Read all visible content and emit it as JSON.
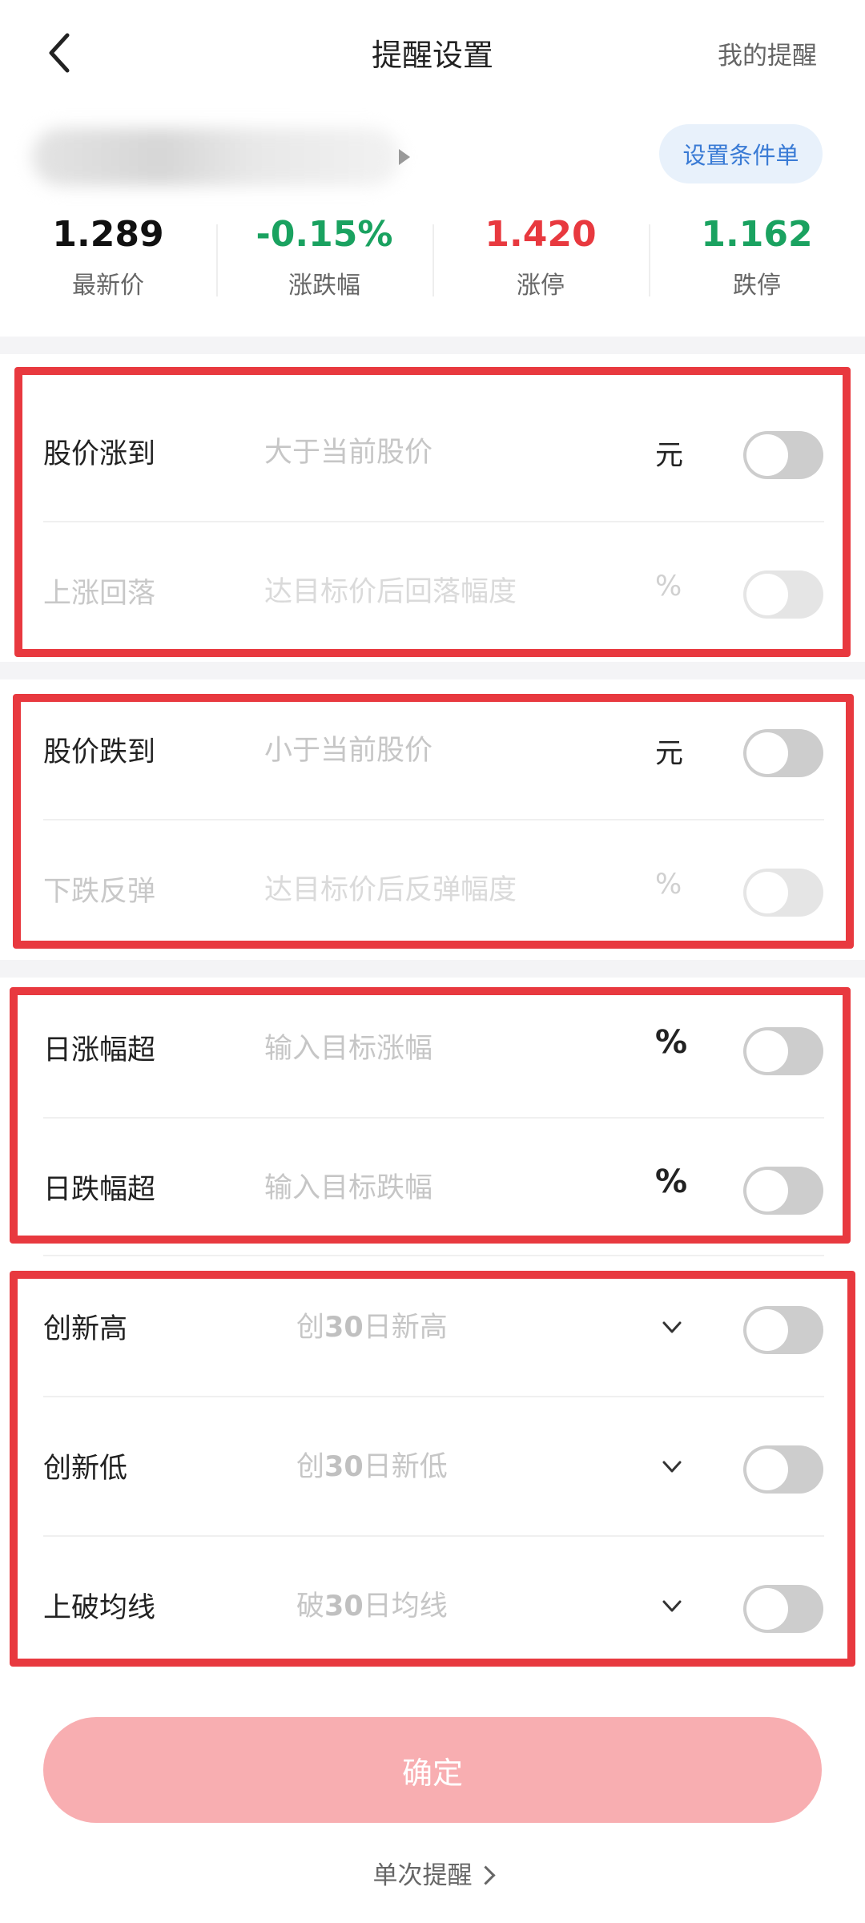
{
  "header": {
    "title": "提醒设置",
    "my_reminders": "我的提醒"
  },
  "stock": {
    "condition_button": "设置条件单"
  },
  "quotes": [
    {
      "value": "1.289",
      "label": "最新价",
      "color": "#111111"
    },
    {
      "value": "-0.15%",
      "label": "涨跌幅",
      "color": "#1aa260"
    },
    {
      "value": "1.420",
      "label": "涨停",
      "color": "#e8393f"
    },
    {
      "value": "1.162",
      "label": "跌停",
      "color": "#1aa260"
    }
  ],
  "rows": {
    "price_up": {
      "label": "股价涨到",
      "placeholder": "大于当前股价",
      "unit": "元"
    },
    "rise_pullback": {
      "label": "上涨回落",
      "placeholder": "达目标价后回落幅度",
      "unit": "%"
    },
    "price_down": {
      "label": "股价跌到",
      "placeholder": "小于当前股价",
      "unit": "元"
    },
    "fall_rebound": {
      "label": "下跌反弹",
      "placeholder": "达目标价后反弹幅度",
      "unit": "%"
    },
    "daily_rise": {
      "label": "日涨幅超",
      "placeholder": "输入目标涨幅",
      "unit": "%"
    },
    "daily_fall": {
      "label": "日跌幅超",
      "placeholder": "输入目标跌幅",
      "unit": "%"
    },
    "new_high": {
      "label": "创新高",
      "ph_prefix": "创",
      "ph_num": "30",
      "ph_suffix": "日新高"
    },
    "new_low": {
      "label": "创新低",
      "ph_prefix": "创",
      "ph_num": "30",
      "ph_suffix": "日新低"
    },
    "break_ma": {
      "label": "上破均线",
      "ph_prefix": "破",
      "ph_num": "30",
      "ph_suffix": "日均线"
    }
  },
  "footer": {
    "confirm": "确定",
    "single_reminder": "单次提醒"
  },
  "colors": {
    "accent_red": "#e8393f",
    "up_red": "#e8393f",
    "down_green": "#1aa260",
    "confirm_disabled": "#f8aeb1"
  }
}
